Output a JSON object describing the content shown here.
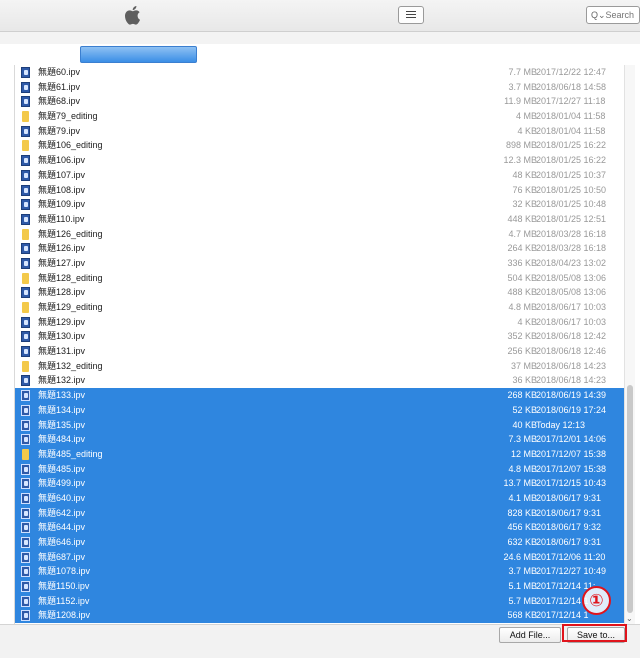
{
  "toolbar": {
    "logo_icon": "apple-logo-icon",
    "view_icon": "list-view-icon",
    "search_placeholder": "Search"
  },
  "import_progress": 1.0,
  "files": [
    {
      "name": "無題60.ipv",
      "size": "7.7 MB",
      "date": "2017/12/22 12:47",
      "type": "ipv",
      "selected": false
    },
    {
      "name": "無題61.ipv",
      "size": "3.7 MB",
      "date": "2018/06/18 14:58",
      "type": "ipv",
      "selected": false
    },
    {
      "name": "無題68.ipv",
      "size": "11.9 MB",
      "date": "2017/12/27 11:18",
      "type": "ipv",
      "selected": false
    },
    {
      "name": "無題79_editing",
      "size": "4 MB",
      "date": "2018/01/04 11:58",
      "type": "folder",
      "selected": false
    },
    {
      "name": "無題79.ipv",
      "size": "4 KB",
      "date": "2018/01/04 11:58",
      "type": "ipv",
      "selected": false
    },
    {
      "name": "無題106_editing",
      "size": "898 MB",
      "date": "2018/01/25 16:22",
      "type": "folder",
      "selected": false
    },
    {
      "name": "無題106.ipv",
      "size": "12.3 MB",
      "date": "2018/01/25 16:22",
      "type": "ipv",
      "selected": false
    },
    {
      "name": "無題107.ipv",
      "size": "48 KB",
      "date": "2018/01/25 10:37",
      "type": "ipv",
      "selected": false
    },
    {
      "name": "無題108.ipv",
      "size": "76 KB",
      "date": "2018/01/25 10:50",
      "type": "ipv",
      "selected": false
    },
    {
      "name": "無題109.ipv",
      "size": "32 KB",
      "date": "2018/01/25 10:48",
      "type": "ipv",
      "selected": false
    },
    {
      "name": "無題110.ipv",
      "size": "448 KB",
      "date": "2018/01/25 12:51",
      "type": "ipv",
      "selected": false
    },
    {
      "name": "無題126_editing",
      "size": "4.7 MB",
      "date": "2018/03/28 16:18",
      "type": "folder",
      "selected": false
    },
    {
      "name": "無題126.ipv",
      "size": "264 KB",
      "date": "2018/03/28 16:18",
      "type": "ipv",
      "selected": false
    },
    {
      "name": "無題127.ipv",
      "size": "336 KB",
      "date": "2018/04/23 13:02",
      "type": "ipv",
      "selected": false
    },
    {
      "name": "無題128_editing",
      "size": "504 KB",
      "date": "2018/05/08 13:06",
      "type": "folder",
      "selected": false
    },
    {
      "name": "無題128.ipv",
      "size": "488 KB",
      "date": "2018/05/08 13:06",
      "type": "ipv",
      "selected": false
    },
    {
      "name": "無題129_editing",
      "size": "4.8 MB",
      "date": "2018/06/17 10:03",
      "type": "folder",
      "selected": false
    },
    {
      "name": "無題129.ipv",
      "size": "4 KB",
      "date": "2018/06/17 10:03",
      "type": "ipv",
      "selected": false
    },
    {
      "name": "無題130.ipv",
      "size": "352 KB",
      "date": "2018/06/18 12:42",
      "type": "ipv",
      "selected": false
    },
    {
      "name": "無題131.ipv",
      "size": "256 KB",
      "date": "2018/06/18 12:46",
      "type": "ipv",
      "selected": false
    },
    {
      "name": "無題132_editing",
      "size": "37 MB",
      "date": "2018/06/18 14:23",
      "type": "folder",
      "selected": false
    },
    {
      "name": "無題132.ipv",
      "size": "36 KB",
      "date": "2018/06/18 14:23",
      "type": "ipv",
      "selected": false
    },
    {
      "name": "無題133.ipv",
      "size": "268 KB",
      "date": "2018/06/19 14:39",
      "type": "ipv",
      "selected": true
    },
    {
      "name": "無題134.ipv",
      "size": "52 KB",
      "date": "2018/06/19 17:24",
      "type": "ipv",
      "selected": true
    },
    {
      "name": "無題135.ipv",
      "size": "40 KB",
      "date": "Today 12:13",
      "type": "ipv",
      "selected": true
    },
    {
      "name": "無題484.ipv",
      "size": "7.3 MB",
      "date": "2017/12/01 14:06",
      "type": "ipv",
      "selected": true
    },
    {
      "name": "無題485_editing",
      "size": "12 MB",
      "date": "2017/12/07 15:38",
      "type": "folder",
      "selected": true
    },
    {
      "name": "無題485.ipv",
      "size": "4.8 MB",
      "date": "2017/12/07 15:38",
      "type": "ipv",
      "selected": true
    },
    {
      "name": "無題499.ipv",
      "size": "13.7 MB",
      "date": "2017/12/15 10:43",
      "type": "ipv",
      "selected": true
    },
    {
      "name": "無題640.ipv",
      "size": "4.1 MB",
      "date": "2018/06/17 9:31",
      "type": "ipv",
      "selected": true
    },
    {
      "name": "無題642.ipv",
      "size": "828 KB",
      "date": "2018/06/17 9:31",
      "type": "ipv",
      "selected": true
    },
    {
      "name": "無題644.ipv",
      "size": "456 KB",
      "date": "2018/06/17 9:32",
      "type": "ipv",
      "selected": true
    },
    {
      "name": "無題646.ipv",
      "size": "632 KB",
      "date": "2018/06/17 9:31",
      "type": "ipv",
      "selected": true
    },
    {
      "name": "無題687.ipv",
      "size": "24.6 MB",
      "date": "2017/12/06 11:20",
      "type": "ipv",
      "selected": true
    },
    {
      "name": "無題1078.ipv",
      "size": "3.7 MB",
      "date": "2017/12/27 10:49",
      "type": "ipv",
      "selected": true
    },
    {
      "name": "無題1150.ipv",
      "size": "5.1 MB",
      "date": "2017/12/14 11:",
      "type": "ipv",
      "selected": true
    },
    {
      "name": "無題1152.ipv",
      "size": "5.7 MB",
      "date": "2017/12/14 1",
      "type": "ipv",
      "selected": true
    },
    {
      "name": "無題1208.ipv",
      "size": "568 KB",
      "date": "2017/12/14 1",
      "type": "ipv",
      "selected": true
    }
  ],
  "buttons": {
    "add_file": "Add File...",
    "save_to": "Save to..."
  },
  "callout": {
    "label": "①",
    "color": "#e0141c"
  },
  "colors": {
    "selection": "#2f86df",
    "ipv_icon": "#2f5aa8",
    "folder_icon": "#f3c94a"
  }
}
